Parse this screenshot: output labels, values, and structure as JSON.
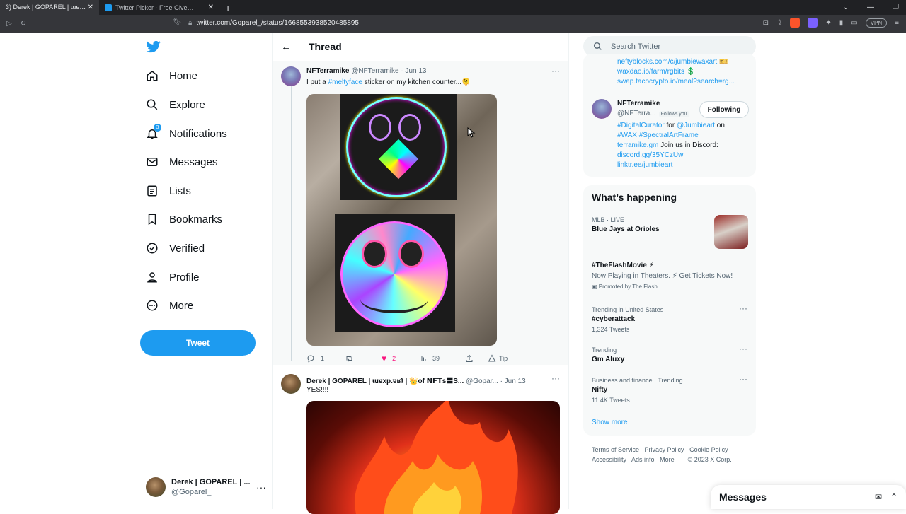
{
  "browser": {
    "tabs": [
      {
        "title": "3) Derek | GOPAREL | ɯɐxp.ɐʁʇ | 👑of ..."
      },
      {
        "title": "Twitter Picker - Free Giveaway Picker"
      }
    ],
    "url": "twitter.com/Goparel_/status/1668553938520485895",
    "vpn_label": "VPN"
  },
  "sidebar": {
    "items": [
      {
        "label": "Home",
        "icon": "home-icon"
      },
      {
        "label": "Explore",
        "icon": "search-icon"
      },
      {
        "label": "Notifications",
        "icon": "bell-icon",
        "badge": "3"
      },
      {
        "label": "Messages",
        "icon": "envelope-icon"
      },
      {
        "label": "Lists",
        "icon": "list-icon"
      },
      {
        "label": "Bookmarks",
        "icon": "bookmark-icon"
      },
      {
        "label": "Verified",
        "icon": "verified-icon"
      },
      {
        "label": "Profile",
        "icon": "person-icon"
      },
      {
        "label": "More",
        "icon": "more-circle-icon"
      }
    ],
    "tweet_button": "Tweet",
    "account": {
      "name": "Derek | GOPAREL | ...",
      "handle": "@Goparel_"
    }
  },
  "main": {
    "header": "Thread",
    "tweets": [
      {
        "name": "NFTerramike",
        "handle": "@NFTerramike",
        "date": "· Jun 13",
        "text_before": "I put a ",
        "hashtag": "#meltyface",
        "text_after": " sticker on my kitchen counter...🫠",
        "replies": "1",
        "retweets": "",
        "likes": "2",
        "views": "39",
        "tip": "Tip"
      },
      {
        "name": "Derek | GOPAREL | ɯɐxp.ɐʁʇ | 👑of ꓠꓝꓔs〓S...",
        "handle": "@Gopar...",
        "date": "· Jun 13",
        "text": "YES!!!!"
      }
    ]
  },
  "right": {
    "search_placeholder": "Search Twitter",
    "profile_card": {
      "links_top": [
        "neftyblocks.com/c/jumbiewaxart 🎫",
        "waxdao.io/farm/rgbits 💲",
        "swap.tacocrypto.io/meal?search=rg..."
      ],
      "name": "NFTerramike",
      "handle": "@NFTerra...",
      "follows_you": "Follows you",
      "follow_button": "Following",
      "bio_line1_a": "#DigitalCurator",
      "bio_line1_b": " for ",
      "bio_line1_c": "@Jumbieart",
      "bio_line1_d": " on",
      "bio_line2_a": "#WAX",
      "bio_line2_b": " #SpectralArtFrame",
      "bio_line3_a": "terramike.gm",
      "bio_line3_b": " Join us in Discord:",
      "bio_line4": "discord.gg/35YCzUw",
      "bio_line5": "linktr.ee/jumbieart"
    },
    "whats_happening": {
      "title": "What’s happening",
      "trends": [
        {
          "meta": "MLB · LIVE",
          "name": "Blue Jays at Orioles"
        },
        {
          "meta": "",
          "name": "#TheFlashMovie ⚡",
          "desc": "Now Playing in Theaters. ⚡ Get Tickets Now!",
          "promo": "Promoted by The Flash"
        },
        {
          "meta": "Trending in United States",
          "name": "#cyberattack",
          "count": "1,324 Tweets"
        },
        {
          "meta": "Trending",
          "name": "Gm Aluxy"
        },
        {
          "meta": "Business and finance · Trending",
          "name": "Nifty",
          "count": "11.4K Tweets"
        }
      ],
      "show_more": "Show more"
    },
    "footer": {
      "line1": [
        "Terms of Service",
        "Privacy Policy",
        "Cookie Policy"
      ],
      "line2": [
        "Accessibility",
        "Ads info",
        "More ···",
        "© 2023 X Corp."
      ]
    }
  },
  "messages_drawer": {
    "title": "Messages"
  },
  "colors": {
    "brand": "#1d9bf0",
    "like": "#f91880",
    "text": "#0f1419",
    "muted": "#536471"
  }
}
